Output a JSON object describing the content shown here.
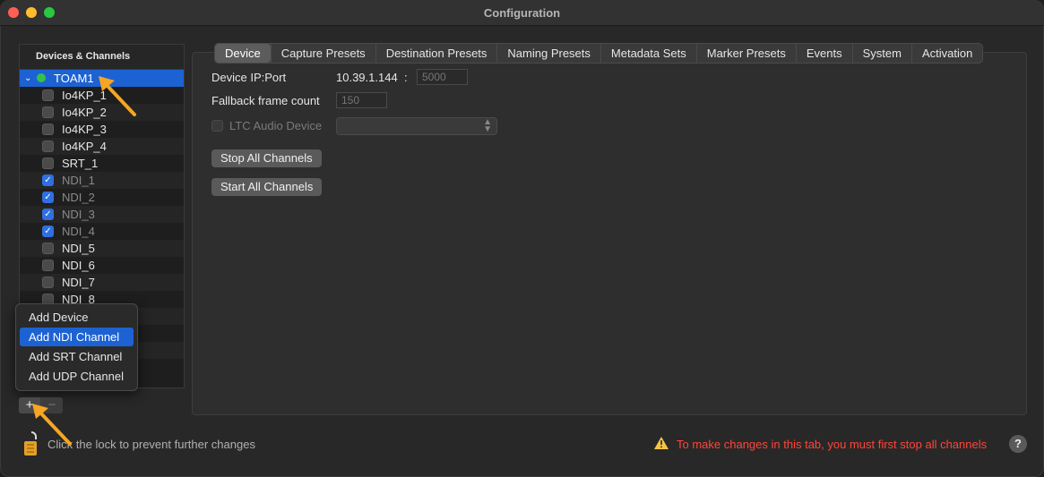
{
  "window": {
    "title": "Configuration"
  },
  "sidebar": {
    "header": "Devices & Channels",
    "device": {
      "label": "TOAM1",
      "status_color": "#35c24a"
    },
    "channels": [
      {
        "label": "Io4KP_1",
        "checked": false,
        "dim": false
      },
      {
        "label": "Io4KP_2",
        "checked": false,
        "dim": false
      },
      {
        "label": "Io4KP_3",
        "checked": false,
        "dim": false
      },
      {
        "label": "Io4KP_4",
        "checked": false,
        "dim": false
      },
      {
        "label": "SRT_1",
        "checked": false,
        "dim": false
      },
      {
        "label": "NDI_1",
        "checked": true,
        "dim": true
      },
      {
        "label": "NDI_2",
        "checked": true,
        "dim": true
      },
      {
        "label": "NDI_3",
        "checked": true,
        "dim": true
      },
      {
        "label": "NDI_4",
        "checked": true,
        "dim": true
      },
      {
        "label": "NDI_5",
        "checked": false,
        "dim": false
      },
      {
        "label": "NDI_6",
        "checked": false,
        "dim": false
      },
      {
        "label": "NDI_7",
        "checked": false,
        "dim": false
      },
      {
        "label": "NDI_8",
        "checked": false,
        "dim": false
      }
    ]
  },
  "context_menu": {
    "items": [
      "Add Device",
      "Add NDI Channel",
      "Add SRT Channel",
      "Add UDP Channel"
    ],
    "highlighted": "Add NDI Channel"
  },
  "controls": {
    "plus": "+",
    "minus": "−"
  },
  "tabs": [
    "Device",
    "Capture Presets",
    "Destination Presets",
    "Naming Presets",
    "Metadata Sets",
    "Marker Presets",
    "Events",
    "System",
    "Activation"
  ],
  "active_tab": "Device",
  "device_tab": {
    "ip_port_label": "Device IP:Port",
    "ip_value": "10.39.1.144",
    "separator": ":",
    "port_placeholder": "5000",
    "fallback_label": "Fallback frame count",
    "fallback_placeholder": "150",
    "ltc_label": "LTC Audio Device",
    "stop_all_label": "Stop All Channels",
    "start_all_label": "Start All Channels"
  },
  "footer": {
    "lock_text": "Click the lock to prevent further changes",
    "warning_text": "To make changes in this tab, you must first stop all channels",
    "help_label": "?"
  },
  "colors": {
    "accent": "#1d62d2",
    "warning": "#ff453a",
    "annotation_arrow": "#f5a623"
  }
}
